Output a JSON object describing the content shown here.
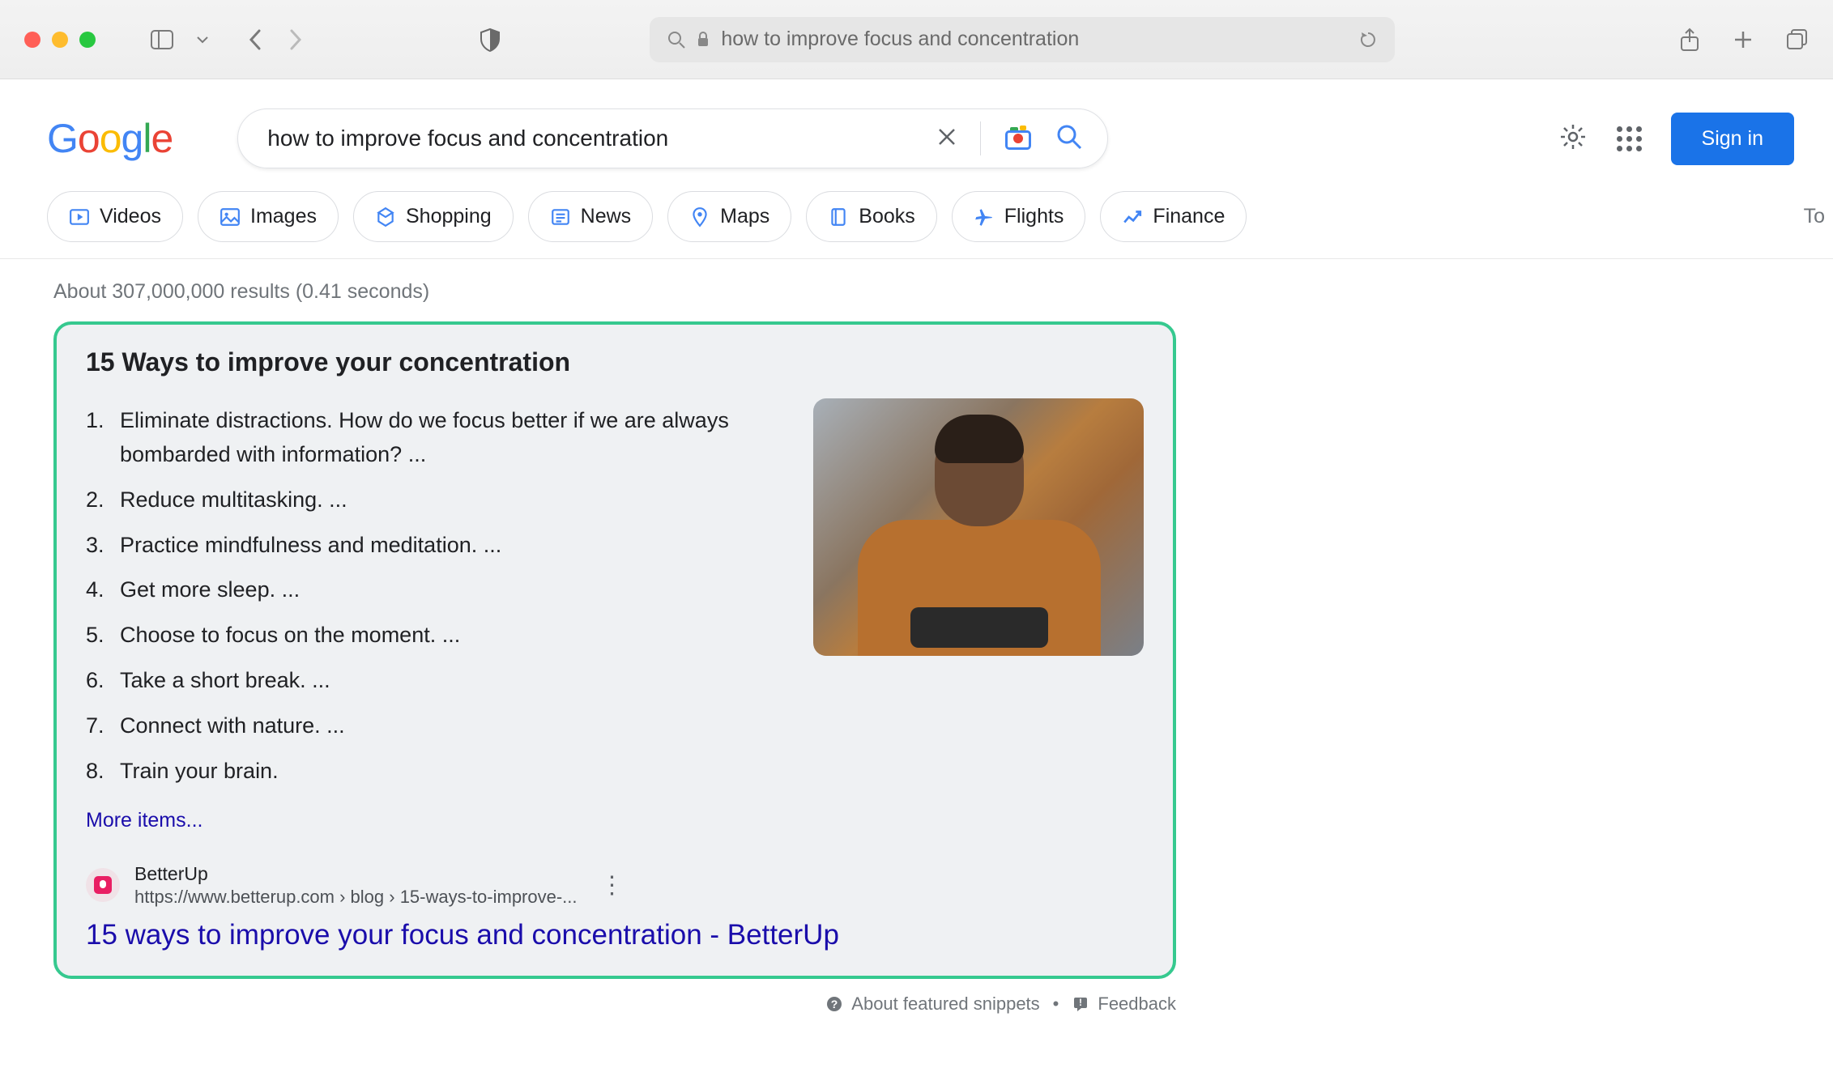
{
  "browser": {
    "address": "how to improve focus and concentration"
  },
  "search": {
    "query": "how to improve focus and concentration"
  },
  "header": {
    "signin": "Sign in"
  },
  "tabs": [
    {
      "label": "Videos"
    },
    {
      "label": "Images"
    },
    {
      "label": "Shopping"
    },
    {
      "label": "News"
    },
    {
      "label": "Maps"
    },
    {
      "label": "Books"
    },
    {
      "label": "Flights"
    },
    {
      "label": "Finance"
    }
  ],
  "tabs_tail": "To",
  "stats": "About 307,000,000 results (0.41 seconds)",
  "snippet": {
    "title": "15 Ways to improve your concentration",
    "items": [
      "Eliminate distractions. How do we focus better if we are always bombarded with information? ...",
      "Reduce multitasking. ...",
      "Practice mindfulness and meditation. ...",
      "Get more sleep. ...",
      "Choose to focus on the moment. ...",
      "Take a short break. ...",
      "Connect with nature. ...",
      "Train your brain."
    ],
    "more": "More items...",
    "source_name": "BetterUp",
    "source_url": "https://www.betterup.com › blog › 15-ways-to-improve-...",
    "result_title": "15 ways to improve your focus and concentration - BetterUp"
  },
  "footer": {
    "about": "About featured snippets",
    "feedback": "Feedback"
  }
}
